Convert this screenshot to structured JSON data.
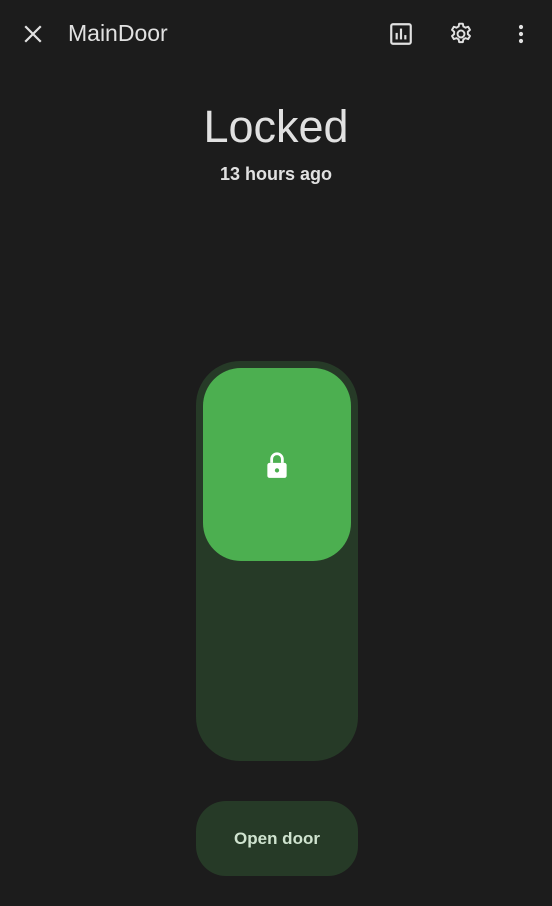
{
  "header": {
    "title": "MainDoor",
    "icons": {
      "close": "close-icon",
      "history": "chart-box-icon",
      "settings": "gear-icon",
      "more": "dots-vertical-icon"
    }
  },
  "state": {
    "label": "Locked",
    "last_changed": "13 hours ago"
  },
  "lock_control": {
    "icon": "lock-icon",
    "locked": true,
    "accent_color": "#4caf50",
    "track_color": "#263a27"
  },
  "actions": {
    "open_door_label": "Open door"
  }
}
